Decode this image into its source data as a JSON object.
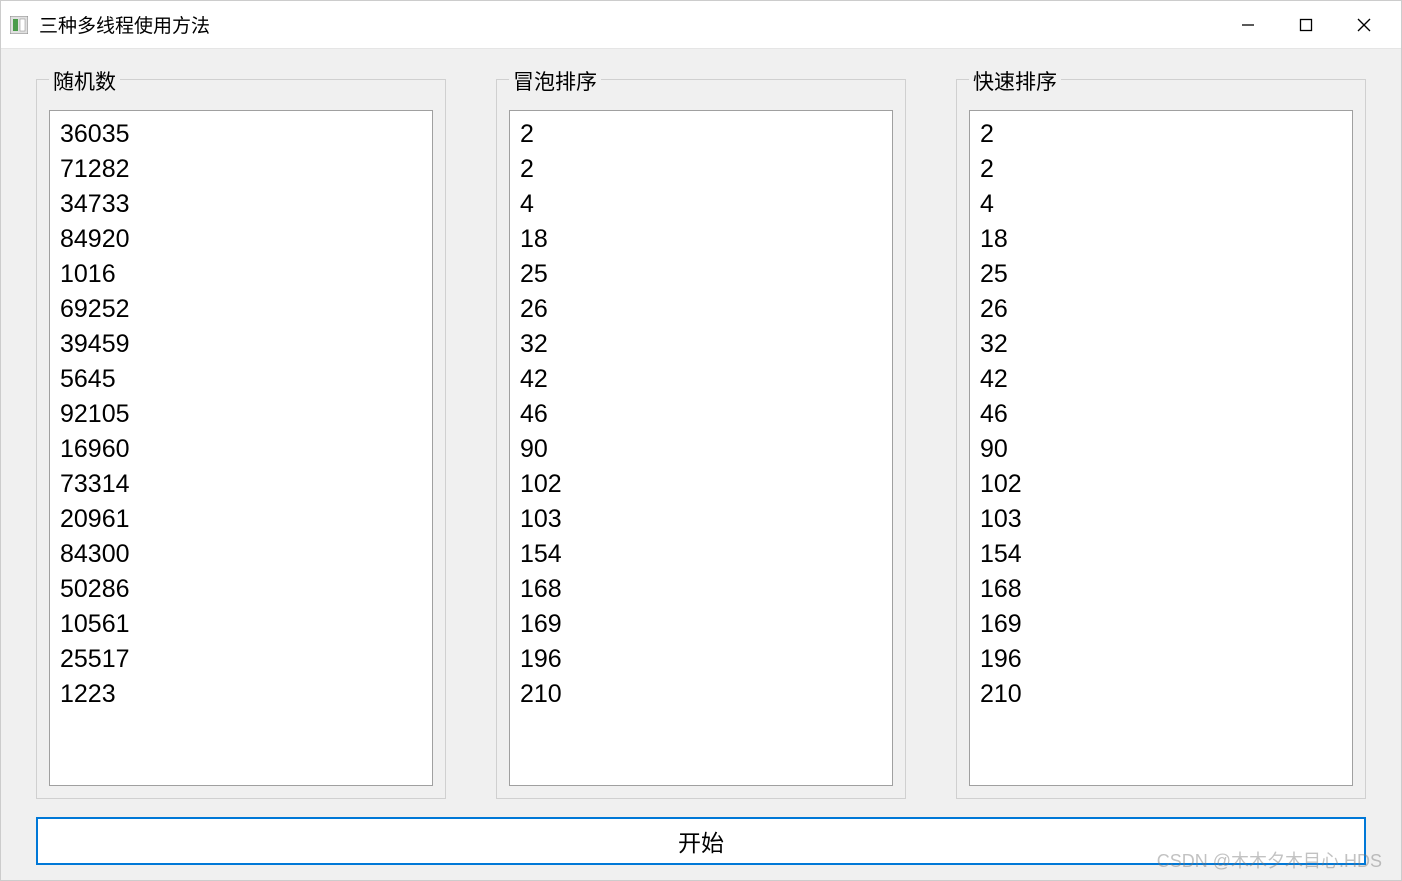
{
  "window": {
    "title": "三种多线程使用方法"
  },
  "groups": {
    "random": {
      "title": "随机数",
      "items": [
        "36035",
        "71282",
        "34733",
        "84920",
        "1016",
        "69252",
        "39459",
        "5645",
        "92105",
        "16960",
        "73314",
        "20961",
        "84300",
        "50286",
        "10561",
        "25517",
        "1223"
      ]
    },
    "bubble": {
      "title": "冒泡排序",
      "items": [
        "2",
        "2",
        "4",
        "18",
        "25",
        "26",
        "32",
        "42",
        "46",
        "90",
        "102",
        "103",
        "154",
        "168",
        "169",
        "196",
        "210"
      ]
    },
    "quick": {
      "title": "快速排序",
      "items": [
        "2",
        "2",
        "4",
        "18",
        "25",
        "26",
        "32",
        "42",
        "46",
        "90",
        "102",
        "103",
        "154",
        "168",
        "169",
        "196",
        "210"
      ]
    }
  },
  "buttons": {
    "start_label": "开始"
  },
  "watermark": "CSDN @木木夕木目心.HDS"
}
